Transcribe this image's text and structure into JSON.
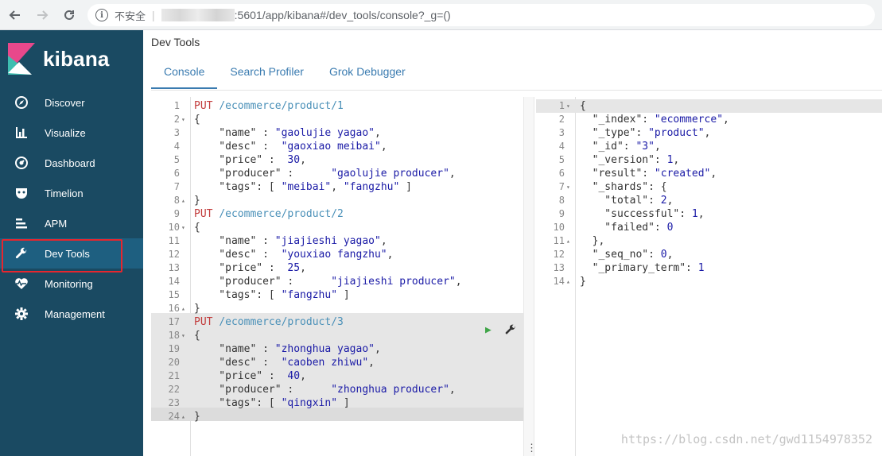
{
  "browser": {
    "insecure_label": "不安全",
    "separator": "|",
    "url": ":5601/app/kibana#/dev_tools/console?_g=()"
  },
  "sidebar": {
    "brand": "kibana",
    "items": [
      {
        "label": "Discover",
        "icon": "compass-icon"
      },
      {
        "label": "Visualize",
        "icon": "bar-chart-icon"
      },
      {
        "label": "Dashboard",
        "icon": "dashboard-gauge-icon"
      },
      {
        "label": "Timelion",
        "icon": "timelion-mask-icon"
      },
      {
        "label": "APM",
        "icon": "apm-bars-icon"
      },
      {
        "label": "Dev Tools",
        "icon": "wrench-icon",
        "active": true
      },
      {
        "label": "Monitoring",
        "icon": "heartbeat-icon"
      },
      {
        "label": "Management",
        "icon": "gear-icon"
      }
    ]
  },
  "main": {
    "title": "Dev Tools",
    "tabs": [
      {
        "label": "Console",
        "active": true
      },
      {
        "label": "Search Profiler"
      },
      {
        "label": "Grok Debugger"
      }
    ]
  },
  "editor": {
    "lines": [
      {
        "n": "1",
        "fold": "",
        "text": "PUT /ecommerce/product/1"
      },
      {
        "n": "2",
        "fold": "▾",
        "text": "{"
      },
      {
        "n": "3",
        "fold": "",
        "text": "    \"name\" : \"gaolujie yagao\","
      },
      {
        "n": "4",
        "fold": "",
        "text": "    \"desc\" :  \"gaoxiao meibai\","
      },
      {
        "n": "5",
        "fold": "",
        "text": "    \"price\" :  30,"
      },
      {
        "n": "6",
        "fold": "",
        "text": "    \"producer\" :      \"gaolujie producer\","
      },
      {
        "n": "7",
        "fold": "",
        "text": "    \"tags\": [ \"meibai\", \"fangzhu\" ]"
      },
      {
        "n": "8",
        "fold": "▴",
        "text": "}"
      },
      {
        "n": "9",
        "fold": "",
        "text": "PUT /ecommerce/product/2"
      },
      {
        "n": "10",
        "fold": "▾",
        "text": "{"
      },
      {
        "n": "11",
        "fold": "",
        "text": "    \"name\" : \"jiajieshi yagao\","
      },
      {
        "n": "12",
        "fold": "",
        "text": "    \"desc\" :  \"youxiao fangzhu\","
      },
      {
        "n": "13",
        "fold": "",
        "text": "    \"price\" :  25,"
      },
      {
        "n": "14",
        "fold": "",
        "text": "    \"producer\" :      \"jiajieshi producer\","
      },
      {
        "n": "15",
        "fold": "",
        "text": "    \"tags\": [ \"fangzhu\" ]"
      },
      {
        "n": "16",
        "fold": "▴",
        "text": "}"
      },
      {
        "n": "17",
        "fold": "",
        "text": "PUT /ecommerce/product/3"
      },
      {
        "n": "18",
        "fold": "▾",
        "text": "{"
      },
      {
        "n": "19",
        "fold": "",
        "text": "    \"name\" : \"zhonghua yagao\","
      },
      {
        "n": "20",
        "fold": "",
        "text": "    \"desc\" :  \"caoben zhiwu\","
      },
      {
        "n": "21",
        "fold": "",
        "text": "    \"price\" :  40,"
      },
      {
        "n": "22",
        "fold": "",
        "text": "    \"producer\" :      \"zhonghua producer\","
      },
      {
        "n": "23",
        "fold": "",
        "text": "    \"tags\": [ \"qingxin\" ]"
      },
      {
        "n": "24",
        "fold": "▴",
        "text": "}"
      }
    ]
  },
  "output": {
    "lines": [
      {
        "n": "1",
        "fold": "▾",
        "text": "{"
      },
      {
        "n": "2",
        "fold": "",
        "text": "  \"_index\": \"ecommerce\","
      },
      {
        "n": "3",
        "fold": "",
        "text": "  \"_type\": \"product\","
      },
      {
        "n": "4",
        "fold": "",
        "text": "  \"_id\": \"3\","
      },
      {
        "n": "5",
        "fold": "",
        "text": "  \"_version\": 1,"
      },
      {
        "n": "6",
        "fold": "",
        "text": "  \"result\": \"created\","
      },
      {
        "n": "7",
        "fold": "▾",
        "text": "  \"_shards\": {"
      },
      {
        "n": "8",
        "fold": "",
        "text": "    \"total\": 2,"
      },
      {
        "n": "9",
        "fold": "",
        "text": "    \"successful\": 1,"
      },
      {
        "n": "10",
        "fold": "",
        "text": "    \"failed\": 0"
      },
      {
        "n": "11",
        "fold": "▴",
        "text": "  },"
      },
      {
        "n": "12",
        "fold": "",
        "text": "  \"_seq_no\": 0,"
      },
      {
        "n": "13",
        "fold": "",
        "text": "  \"_primary_term\": 1"
      },
      {
        "n": "14",
        "fold": "▴",
        "text": "}"
      }
    ]
  },
  "divider_dots": "⋮",
  "watermark": "https://blog.csdn.net/gwd1154978352",
  "colors": {
    "sidebar_bg": "#1a4a62",
    "active_item_bg": "#1e5f80",
    "highlight_border": "#e7262e",
    "tab_accent": "#3a7bb0",
    "method": "#c23a3a",
    "path": "#4a90b8",
    "value": "#1a1aa6",
    "run": "#3fa548"
  }
}
